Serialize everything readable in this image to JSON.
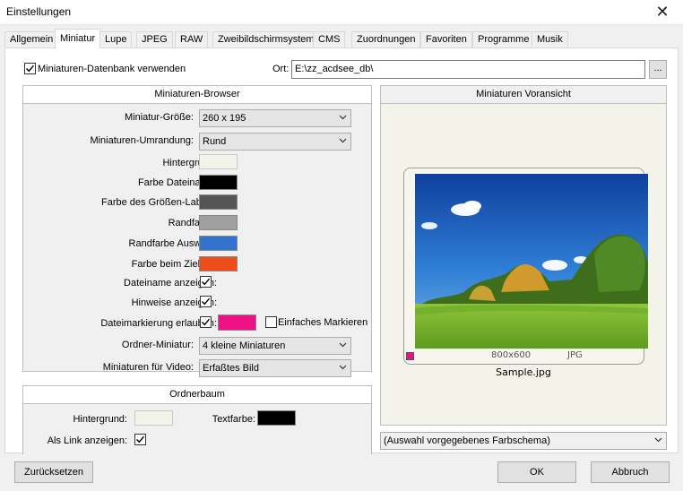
{
  "window": {
    "title": "Einstellungen",
    "close_glyph": "✕"
  },
  "tabs": [
    {
      "label": "Allgemein"
    },
    {
      "label": "Miniatur"
    },
    {
      "label": "Lupe"
    },
    {
      "label": "JPEG"
    },
    {
      "label": "RAW"
    },
    {
      "label": "Zweibildschirmsystem"
    },
    {
      "label": "CMS"
    },
    {
      "label": "Zuordnungen"
    },
    {
      "label": "Favoriten"
    },
    {
      "label": "Programme"
    },
    {
      "label": "Musik"
    }
  ],
  "db": {
    "checkbox_label": "Miniaturen-Datenbank verwenden",
    "checked": true,
    "ort_label": "Ort:",
    "ort_value": "E:\\zz_acdsee_db\\",
    "browse_label": "..."
  },
  "browser": {
    "header": "Miniaturen-Browser",
    "size_label": "Miniatur-Größe:",
    "size_value": "260 x 195",
    "border_label": "Miniaturen-Umrandung:",
    "border_value": "Rund",
    "bg_label": "Hintergrund:",
    "filename_color_label": "Farbe Dateiname:",
    "size_label_color_label": "Farbe des Größen-Labels:",
    "frame_color_label": "Randfarbe:",
    "frame_sel_color_label": "Randfarbe Auswahl:",
    "drag_color_label": "Farbe beim Ziehen:",
    "show_filename_label": "Dateiname anzeigen:",
    "show_hints_label": "Hinweise anzeigen:",
    "allow_mark_label": "Dateimarkierung erlauben:",
    "simple_mark_label": "Einfaches Markieren",
    "folder_thumb_label": "Ordner-Miniatur:",
    "folder_thumb_value": "4 kleine Miniaturen",
    "video_thumb_label": "Miniaturen für Video:",
    "video_thumb_value": "Erfaßtes Bild",
    "colors": {
      "bg": "#f3f3ea",
      "filename": "#000000",
      "size_label": "#555555",
      "frame": "#a0a0a0",
      "frame_sel": "#3472cd",
      "drag": "#ec4d1a",
      "mark": "#ee1185"
    }
  },
  "folder_tree": {
    "header": "Ordnerbaum",
    "bg_label": "Hintergrund:",
    "text_color_label": "Textfarbe:",
    "link_label": "Als Link anzeigen:",
    "colors": {
      "bg": "#f3f3ea",
      "text": "#000000"
    }
  },
  "preview": {
    "header": "Miniaturen Voransicht",
    "dimensions": "800x600",
    "format": "JPG",
    "filename": "Sample.jpg",
    "scheme_value": "(Auswahl vorgegebenes Farbschema)"
  },
  "footer": {
    "reset_label": "Zurücksetzen",
    "ok_label": "OK",
    "cancel_label": "Abbruch"
  }
}
